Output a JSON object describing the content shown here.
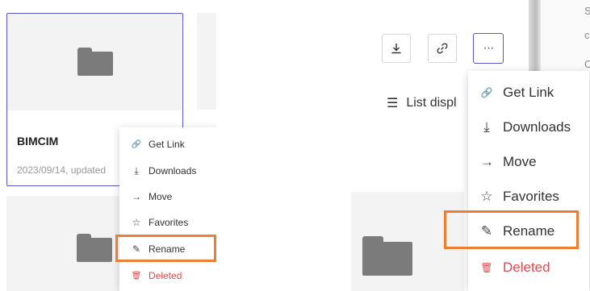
{
  "left": {
    "card": {
      "title": "BIMCIM",
      "date": "2023/09/14, updated"
    },
    "menu": {
      "items": [
        {
          "icon": "link-icon",
          "glyph": "🔗",
          "label": "Get Link"
        },
        {
          "icon": "download-icon",
          "glyph": "⤓",
          "label": "Downloads"
        },
        {
          "icon": "arrow-right-icon",
          "glyph": "→",
          "label": "Move"
        },
        {
          "icon": "star-icon",
          "glyph": "☆",
          "label": "Favorites"
        },
        {
          "icon": "pencil-icon",
          "glyph": "✎",
          "label": "Rename"
        },
        {
          "icon": "trash-icon",
          "glyph": "🗑",
          "label": "Deleted"
        }
      ]
    }
  },
  "right": {
    "toolbar": {
      "more_glyph": "···"
    },
    "list_label": "List displ",
    "side_letters": [
      "S",
      "c",
      "C"
    ],
    "menu": {
      "items": [
        {
          "icon": "link-icon",
          "glyph": "🔗",
          "label": "Get Link"
        },
        {
          "icon": "download-icon",
          "glyph": "⤓",
          "label": "Downloads"
        },
        {
          "icon": "arrow-right-icon",
          "glyph": "→",
          "label": "Move"
        },
        {
          "icon": "star-icon",
          "glyph": "☆",
          "label": "Favorites"
        },
        {
          "icon": "pencil-icon",
          "glyph": "✎",
          "label": "Rename"
        },
        {
          "icon": "trash-icon",
          "glyph": "🗑",
          "label": "Deleted"
        }
      ]
    }
  },
  "colors": {
    "accent": "#5b54c9",
    "highlight": "#ed7d31",
    "danger": "#e5484d",
    "folder": "#7b7b7b"
  }
}
